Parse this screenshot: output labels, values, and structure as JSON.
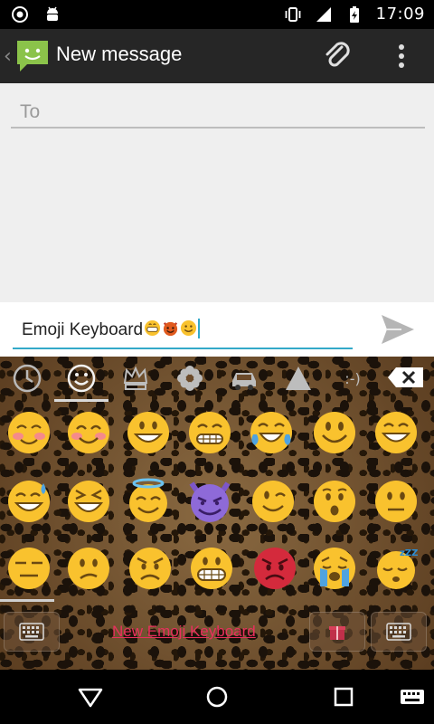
{
  "status_bar": {
    "time": "17:09",
    "left_icons": [
      "camera-icon",
      "android-icon"
    ],
    "right_icons": [
      "vibrate-icon",
      "signal-icon",
      "battery-charging-icon"
    ]
  },
  "action_bar": {
    "title": "New message",
    "back_glyph": "‹",
    "icons": [
      "messaging-app-icon",
      "paperclip-icon",
      "overflow-menu-icon"
    ]
  },
  "compose": {
    "to_placeholder": "To"
  },
  "message": {
    "text": "Emoji Keyboard",
    "trailing_emojis": [
      "grinning-face",
      "smiling-devil",
      "smiling-face"
    ],
    "send_icon": "send-icon"
  },
  "keyboard": {
    "categories": [
      "recent-icon",
      "smiley-icon",
      "crown-icon",
      "flower-icon",
      "car-icon",
      "triangle-icon",
      "emoticon-icon"
    ],
    "active_category": "smiley-icon",
    "delete_icon": "backspace-icon",
    "emojis": [
      [
        "relaxed-face",
        "blushing-face",
        "grinning-face",
        "grimacing-face",
        "joy-face",
        "smiley-face",
        "big-grin-face"
      ],
      [
        "sweat-smile-face",
        "laughing-face",
        "halo-face",
        "smiling-imp-face",
        "winking-face",
        "hushed-face",
        "neutral-face"
      ],
      [
        "expressionless-face",
        "confused-face",
        "angry-face",
        "grimacing-teeth-face",
        "rage-face",
        "crying-face",
        "sleeping-face"
      ]
    ],
    "promo_link": "New Emoji Keyboard",
    "bottom_keys": [
      "keyboard-switch-icon",
      "gift-icon",
      "keyboard-icon"
    ]
  },
  "nav_bar": {
    "buttons": [
      "back-icon",
      "home-icon",
      "recents-icon",
      "keyboard-status-icon"
    ]
  },
  "colors": {
    "accent": "#33a9c9",
    "action_bar": "#262626",
    "emoji_yellow": "#f9c22e",
    "promo": "#e8305d"
  }
}
